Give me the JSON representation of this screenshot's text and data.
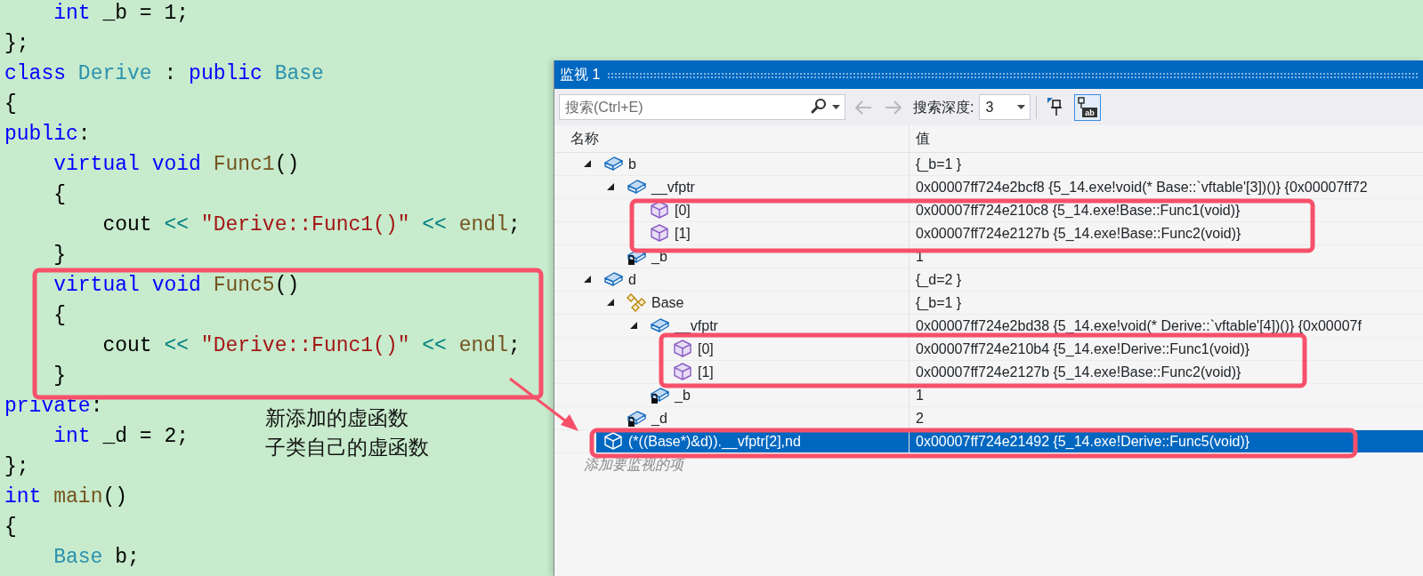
{
  "editor": {
    "lines": [
      [
        {
          "kind": "keyword",
          "text": "    int"
        },
        {
          "kind": "plain",
          "text": " _b = 1;"
        }
      ],
      [
        {
          "kind": "plain",
          "text": "};"
        }
      ],
      [
        {
          "kind": "keyword",
          "text": "class "
        },
        {
          "kind": "type",
          "text": "Derive"
        },
        {
          "kind": "plain",
          "text": " : "
        },
        {
          "kind": "keyword",
          "text": "public "
        },
        {
          "kind": "type",
          "text": "Base"
        }
      ],
      [
        {
          "kind": "plain",
          "text": "{"
        }
      ],
      [
        {
          "kind": "keyword",
          "text": "public"
        },
        {
          "kind": "plain",
          "text": ":"
        }
      ],
      [
        {
          "kind": "keyword",
          "text": "    virtual void "
        },
        {
          "kind": "function",
          "text": "Func1"
        },
        {
          "kind": "plain",
          "text": "()"
        }
      ],
      [
        {
          "kind": "plain",
          "text": "    {"
        }
      ],
      [
        {
          "kind": "plain",
          "text": "        cout "
        },
        {
          "kind": "operator",
          "text": "<< "
        },
        {
          "kind": "string",
          "text": "\"Derive::Func1()\" "
        },
        {
          "kind": "operator",
          "text": "<< "
        },
        {
          "kind": "function",
          "text": "endl"
        },
        {
          "kind": "plain",
          "text": ";"
        }
      ],
      [
        {
          "kind": "plain",
          "text": "    }"
        }
      ],
      [
        {
          "kind": "keyword",
          "text": "    virtual void "
        },
        {
          "kind": "function",
          "text": "Func5"
        },
        {
          "kind": "plain",
          "text": "()"
        }
      ],
      [
        {
          "kind": "plain",
          "text": "    {"
        }
      ],
      [
        {
          "kind": "plain",
          "text": "        cout "
        },
        {
          "kind": "operator",
          "text": "<< "
        },
        {
          "kind": "string",
          "text": "\"Derive::Func1()\" "
        },
        {
          "kind": "operator",
          "text": "<< "
        },
        {
          "kind": "function",
          "text": "endl"
        },
        {
          "kind": "plain",
          "text": ";"
        }
      ],
      [
        {
          "kind": "plain",
          "text": "    }"
        }
      ],
      [
        {
          "kind": "keyword",
          "text": "private"
        },
        {
          "kind": "plain",
          "text": ":"
        }
      ],
      [
        {
          "kind": "keyword",
          "text": "    int"
        },
        {
          "kind": "plain",
          "text": " _d = 2;"
        }
      ],
      [
        {
          "kind": "plain",
          "text": "};"
        }
      ],
      [
        {
          "kind": "keyword",
          "text": "int "
        },
        {
          "kind": "function",
          "text": "main"
        },
        {
          "kind": "plain",
          "text": "()"
        }
      ],
      [
        {
          "kind": "plain",
          "text": "{"
        }
      ],
      [
        {
          "kind": "type",
          "text": "    Base"
        },
        {
          "kind": "plain",
          "text": " b;"
        }
      ]
    ]
  },
  "annotation": {
    "lines": [
      "新添加的虚函数",
      "子类自己的虚函数"
    ]
  },
  "window": {
    "title": "监视 1"
  },
  "toolbar": {
    "search": {
      "placeholder": "搜索(Ctrl+E)"
    },
    "history_buttons": [
      {
        "kind": "back",
        "disabled": true
      },
      {
        "kind": "forward",
        "disabled": true
      }
    ],
    "depth_label": "搜索深度:",
    "depth": "3",
    "buttons": [
      {
        "kind": "pin",
        "selected": false
      },
      {
        "kind": "pin-text",
        "label": "ab",
        "selected": true
      }
    ]
  },
  "columns": [
    "名称",
    "值"
  ],
  "items": [
    {
      "name": "b",
      "value": "{_b=1 }",
      "kind": "object",
      "expanded": true,
      "selected": false,
      "children": [
        {
          "name": "__vfptr",
          "value": "0x00007ff724e2bcf8 {5_14.exe!void(* Base::`vftable'[3])()} {0x00007ff72",
          "kind": "object",
          "expanded": true,
          "selected": false,
          "children": [
            {
              "name": "[0]",
              "value": "0x00007ff724e210c8 {5_14.exe!Base::Func1(void)}",
              "kind": "element",
              "selected": false
            },
            {
              "name": "[1]",
              "value": "0x00007ff724e2127b {5_14.exe!Base::Func2(void)}",
              "kind": "element",
              "selected": false
            }
          ]
        },
        {
          "name": "_b",
          "value": "1",
          "kind": "locked",
          "selected": false
        }
      ]
    },
    {
      "name": "d",
      "value": "{_d=2 }",
      "kind": "object",
      "expanded": true,
      "selected": false,
      "children": [
        {
          "name": "Base",
          "value": "{_b=1 }",
          "kind": "base",
          "expanded": true,
          "selected": false,
          "children": [
            {
              "name": "__vfptr",
              "value": "0x00007ff724e2bd38 {5_14.exe!void(* Derive::`vftable'[4])()} {0x00007f",
              "kind": "object",
              "expanded": true,
              "selected": false,
              "children": [
                {
                  "name": "[0]",
                  "value": "0x00007ff724e210b4 {5_14.exe!Derive::Func1(void)}",
                  "kind": "element",
                  "selected": false
                },
                {
                  "name": "[1]",
                  "value": "0x00007ff724e2127b {5_14.exe!Base::Func2(void)}",
                  "kind": "element",
                  "selected": false
                }
              ]
            },
            {
              "name": "_b",
              "value": "1",
              "kind": "locked",
              "selected": false
            }
          ]
        },
        {
          "name": "_d",
          "value": "2",
          "kind": "locked",
          "selected": false
        }
      ]
    },
    {
      "name": "(*((Base*)&d)).__vfptr[2],nd",
      "value": "0x00007ff724e21492 {5_14.exe!Derive::Func5(void)}",
      "kind": "element",
      "selected": true
    }
  ],
  "add_item": {
    "placeholder": "添加要监视的项"
  }
}
